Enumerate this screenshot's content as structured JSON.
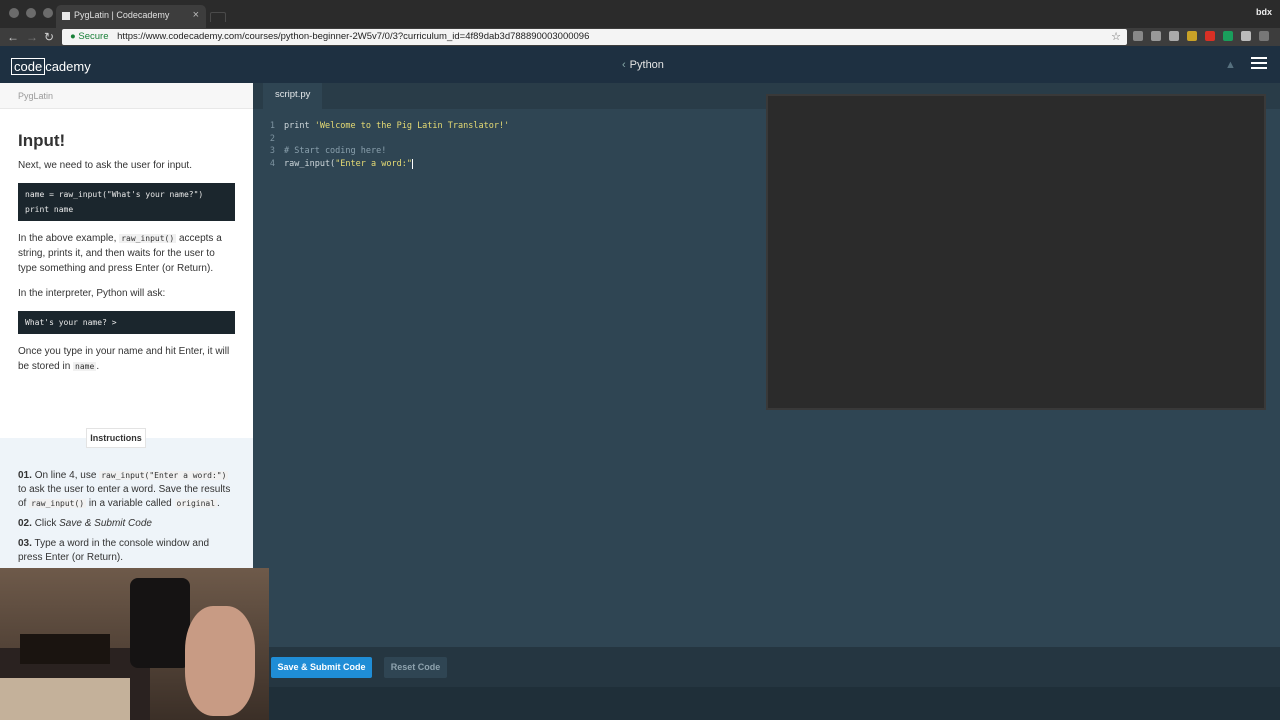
{
  "browser": {
    "tab_title": "PygLatin | Codecademy",
    "tab_close": "×",
    "url": "https://www.codecademy.com/courses/python-beginner-2W5v7/0/3?curriculum_id=4f89dab3d788890003000096",
    "secure_label": "Secure",
    "user_label": "bdx",
    "nav": {
      "back": "←",
      "forward": "→",
      "reload": "↻"
    },
    "star": "☆"
  },
  "header": {
    "logo_code": "code",
    "logo_cademy": "cademy",
    "breadcrumb": "Python",
    "breadcrumb_chevron": "‹",
    "bell": "🔔"
  },
  "lesson": {
    "course": "PygLatin",
    "title": "Input!",
    "intro": "Next, we need to ask the user for input.",
    "example_code": "name = raw_input(\"What's your name?\")\nprint name",
    "para1_pre": "In the above example,",
    "para1_code": "raw_input()",
    "para1_post": "accepts a string, prints it, and then waits for the user to type something and press Enter (or Return).",
    "para2": "In the interpreter, Python will ask:",
    "prompt_example": "What's your name? >",
    "para3_pre": "Once you type in your name and hit Enter, it will be stored in",
    "para3_code": "name",
    "para3_post": "."
  },
  "instructions": {
    "tab_label": "Instructions",
    "step1_num": "01.",
    "step1_pre": "On line 4, use",
    "step1_code1": "raw_input(\"Enter a word:\")",
    "step1_mid": "to ask the user to enter a word. Save the results of",
    "step1_code2": "raw_input()",
    "step1_mid2": "in a variable called",
    "step1_code3": "original",
    "step1_end": ".",
    "step2_num": "02.",
    "step2_pre": "Click",
    "step2_em": "Save & Submit Code",
    "step3_num": "03.",
    "step3_text": "Type a word in the console window and press Enter (or Return)."
  },
  "editor": {
    "file_tab": "script.py",
    "lines": [
      {
        "num": "1",
        "pre": "print ",
        "str": "'Welcome to the Pig Latin Translator!'",
        "cmt": ""
      },
      {
        "num": "2",
        "pre": "",
        "str": "",
        "cmt": ""
      },
      {
        "num": "3",
        "pre": "",
        "str": "",
        "cmt": "# Start coding here!"
      },
      {
        "num": "4",
        "pre": "raw_input(",
        "str": "\"Enter a word:\"",
        "cmt": ""
      }
    ]
  },
  "footer": {
    "submit_label": "Save & Submit Code",
    "reset_label": "Reset Code"
  },
  "colors": {
    "accent": "#1f8dd6",
    "editor_bg": "#2f4553",
    "header_bg": "#1e3041",
    "string": "#e6db74"
  }
}
